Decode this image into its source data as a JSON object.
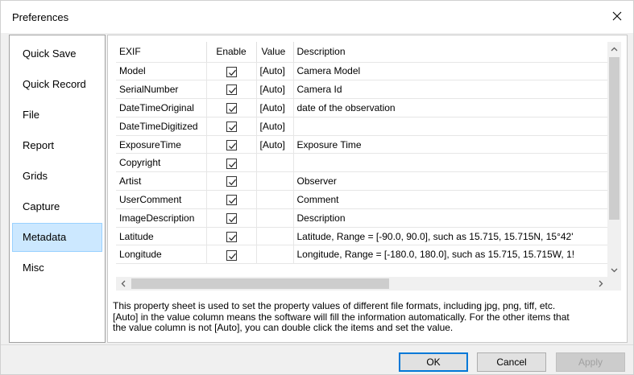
{
  "window": {
    "title": "Preferences"
  },
  "nav": {
    "items": [
      {
        "label": "Quick Save"
      },
      {
        "label": "Quick Record"
      },
      {
        "label": "File"
      },
      {
        "label": "Report"
      },
      {
        "label": "Grids"
      },
      {
        "label": "Capture"
      },
      {
        "label": "Metadata",
        "active": true
      },
      {
        "label": "Misc"
      }
    ]
  },
  "grid": {
    "columns": [
      "EXIF",
      "Enable",
      "Value",
      "Description"
    ],
    "rows": [
      {
        "exif": "Model",
        "enabled": true,
        "value": "[Auto]",
        "description": "Camera Model"
      },
      {
        "exif": "SerialNumber",
        "enabled": true,
        "value": "[Auto]",
        "description": "Camera Id"
      },
      {
        "exif": "DateTimeOriginal",
        "enabled": true,
        "value": "[Auto]",
        "description": "date of the observation"
      },
      {
        "exif": "DateTimeDigitized",
        "enabled": true,
        "value": "[Auto]",
        "description": ""
      },
      {
        "exif": "ExposureTime",
        "enabled": true,
        "value": "[Auto]",
        "description": "Exposure Time"
      },
      {
        "exif": "Copyright",
        "enabled": true,
        "value": "",
        "description": ""
      },
      {
        "exif": "Artist",
        "enabled": true,
        "value": "",
        "description": "Observer"
      },
      {
        "exif": "UserComment",
        "enabled": true,
        "value": "",
        "description": "Comment"
      },
      {
        "exif": "ImageDescription",
        "enabled": true,
        "value": "",
        "description": "Description"
      },
      {
        "exif": "Latitude",
        "enabled": true,
        "value": "",
        "description": "Latitude, Range = [-90.0, 90.0], such as 15.715, 15.715N, 15°42'"
      },
      {
        "exif": "Longitude",
        "enabled": true,
        "value": "",
        "description": "Longitude, Range = [-180.0, 180.0], such as 15.715, 15.715W, 1!"
      }
    ]
  },
  "help_text": "This property sheet is used to set the property values of different file formats, including jpg, png, tiff, etc.\n[Auto] in the value column means the software will fill the information automatically. For the other items that\nthe value column is not [Auto], you can double click the items and set the value.",
  "buttons": {
    "ok": "OK",
    "cancel": "Cancel",
    "apply": "Apply"
  },
  "icons": {
    "close": "close-icon",
    "checkbox": "checkmark-icon",
    "scroll_up": "chevron-up-icon",
    "scroll_down": "chevron-down-icon",
    "scroll_left": "chevron-left-icon",
    "scroll_right": "chevron-right-icon"
  },
  "colors": {
    "accent": "#0078d7",
    "selected_bg": "#cce8ff",
    "selected_border": "#99d1ff"
  }
}
